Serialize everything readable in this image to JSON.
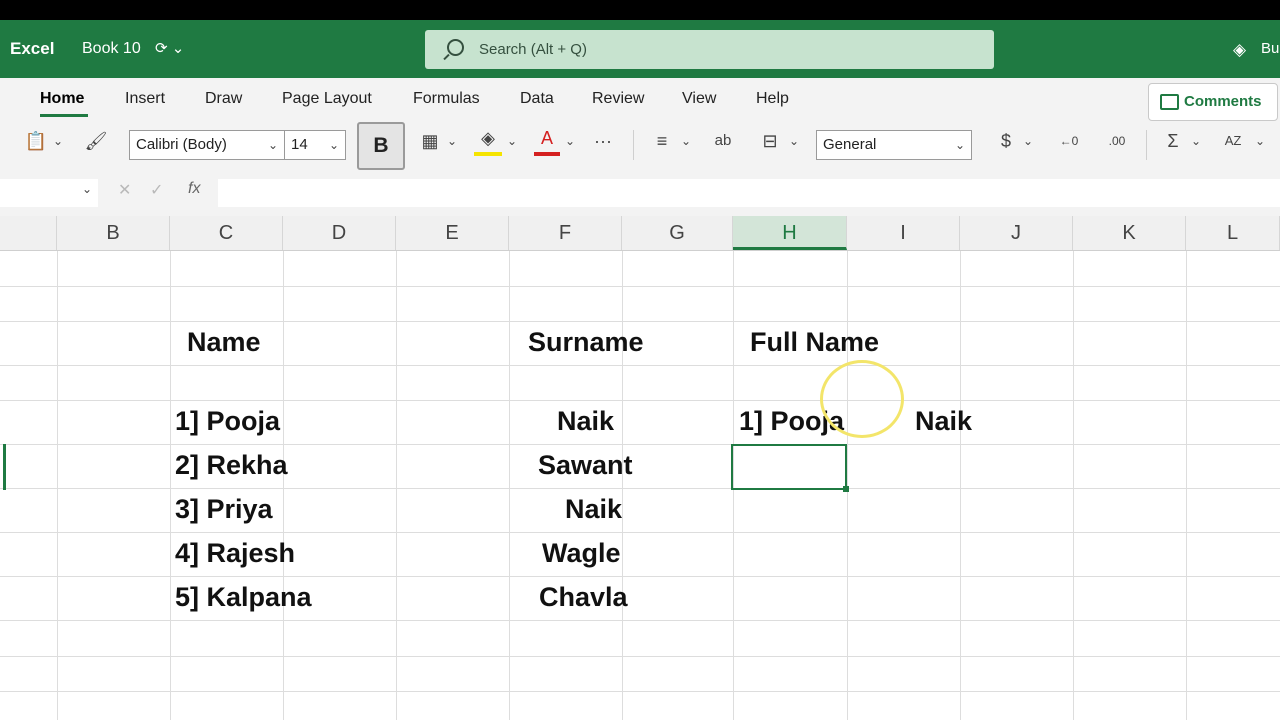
{
  "title_bar": {
    "app_name": "Excel",
    "book_name": "Book 10",
    "book_icons": "⟳ ⌄",
    "search_placeholder": "Search (Alt + Q)",
    "right_label": "Bu"
  },
  "ribbon": {
    "tabs": [
      "Home",
      "Insert",
      "Draw",
      "Page Layout",
      "Formulas",
      "Data",
      "Review",
      "View",
      "Help"
    ],
    "active_tab": "Home",
    "comments_label": "Comments",
    "font_name": "Calibri (Body)",
    "font_size": "14",
    "bold_label": "B",
    "number_format": "General",
    "icons": {
      "paste": "📋",
      "format_painter": "🖌",
      "borders": "▦",
      "fill_color": "◈",
      "font_color": "A",
      "more": "···",
      "align": "≡",
      "wrap": "ab",
      "merge": "⊟",
      "currency": "$",
      "increase_decimal": "←0",
      "decrease_decimal": ".00",
      "sum": "Σ",
      "sort_filter": "AZ"
    }
  },
  "formula_bar": {
    "cancel_icon": "✕",
    "enter_icon": "✓",
    "fx_label": "fx"
  },
  "columns": [
    "B",
    "C",
    "D",
    "E",
    "F",
    "G",
    "H",
    "I",
    "J",
    "K",
    "L"
  ],
  "selected_column": "H",
  "cells": {
    "c_header": "Name",
    "f_header": "Surname",
    "h_header": "Full Name",
    "names": [
      "1] Pooja",
      "2] Rekha",
      "3] Priya",
      "4] Rajesh",
      "5] Kalpana"
    ],
    "surnames": [
      "Naik",
      "Sawant",
      "Naik",
      "Wagle",
      "Chavla"
    ],
    "h_row1": "1] Pooja",
    "i_row1": "Naik"
  },
  "colors": {
    "brand_green": "#1f7a42",
    "search_bg": "#c7e3cf",
    "cursor_highlight": "#f3e56a",
    "fill_accent": "#f5e400",
    "font_accent": "#d42020"
  }
}
